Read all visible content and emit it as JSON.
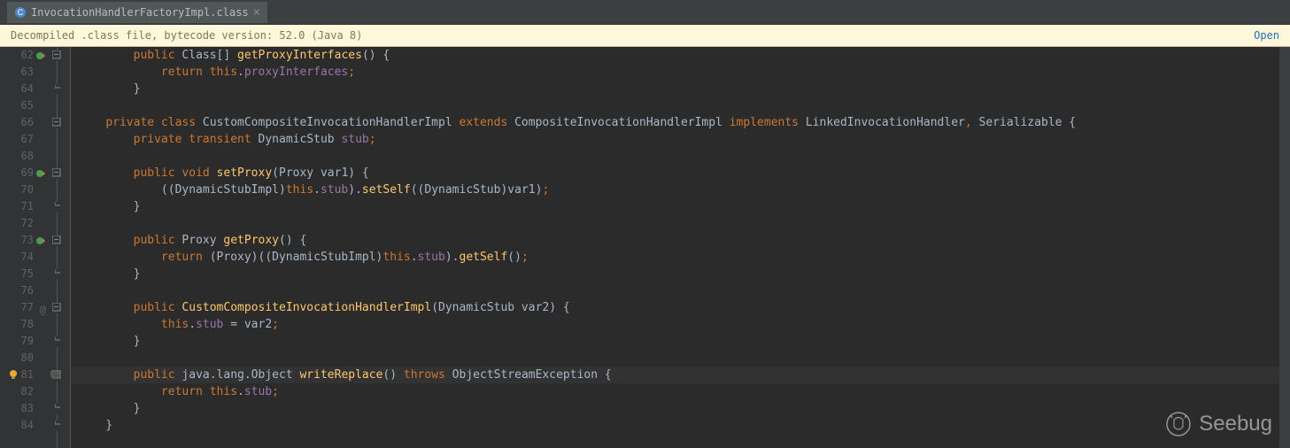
{
  "tab": {
    "filename": "InvocationHandlerFactoryImpl.class"
  },
  "infoBar": {
    "message": "Decompiled .class file, bytecode version: 52.0 (Java 8)",
    "link": "Open"
  },
  "code": {
    "lines": [
      {
        "num": 62,
        "override": true,
        "fold": "open",
        "tokens": [
          [
            "plain",
            "        "
          ],
          [
            "kw",
            "public"
          ],
          [
            "plain",
            " Class[] "
          ],
          [
            "method",
            "getProxyInterfaces"
          ],
          [
            "plain",
            "() {"
          ]
        ]
      },
      {
        "num": 63,
        "tokens": [
          [
            "plain",
            "            "
          ],
          [
            "kw",
            "return "
          ],
          [
            "kw",
            "this"
          ],
          [
            "plain",
            "."
          ],
          [
            "field",
            "proxyInterfaces"
          ],
          [
            "semi",
            ";"
          ]
        ]
      },
      {
        "num": 64,
        "fold": "close",
        "tokens": [
          [
            "plain",
            "        }"
          ]
        ]
      },
      {
        "num": 65,
        "tokens": [
          [
            "plain",
            ""
          ]
        ]
      },
      {
        "num": 66,
        "fold": "open",
        "tokens": [
          [
            "plain",
            "    "
          ],
          [
            "kw",
            "private class"
          ],
          [
            "plain",
            " CustomCompositeInvocationHandlerImpl "
          ],
          [
            "kw",
            "extends"
          ],
          [
            "plain",
            " CompositeInvocationHandlerImpl "
          ],
          [
            "kw",
            "implements"
          ],
          [
            "plain",
            " LinkedInvocationHandler"
          ],
          [
            "semi",
            ","
          ],
          [
            "plain",
            " Serializable {"
          ]
        ]
      },
      {
        "num": 67,
        "tokens": [
          [
            "plain",
            "        "
          ],
          [
            "kw",
            "private transient"
          ],
          [
            "plain",
            " DynamicStub "
          ],
          [
            "field",
            "stub"
          ],
          [
            "semi",
            ";"
          ]
        ]
      },
      {
        "num": 68,
        "tokens": [
          [
            "plain",
            ""
          ]
        ]
      },
      {
        "num": 69,
        "override": true,
        "fold": "open",
        "tokens": [
          [
            "plain",
            "        "
          ],
          [
            "kw",
            "public void "
          ],
          [
            "method",
            "setProxy"
          ],
          [
            "plain",
            "(Proxy var1) {"
          ]
        ]
      },
      {
        "num": 70,
        "tokens": [
          [
            "plain",
            "            ((DynamicStubImpl)"
          ],
          [
            "kw",
            "this"
          ],
          [
            "plain",
            "."
          ],
          [
            "field",
            "stub"
          ],
          [
            "plain",
            ")."
          ],
          [
            "method",
            "setSelf"
          ],
          [
            "plain",
            "((DynamicStub)var1)"
          ],
          [
            "semi",
            ";"
          ]
        ]
      },
      {
        "num": 71,
        "fold": "close",
        "tokens": [
          [
            "plain",
            "        }"
          ]
        ]
      },
      {
        "num": 72,
        "tokens": [
          [
            "plain",
            ""
          ]
        ]
      },
      {
        "num": 73,
        "override": true,
        "fold": "open",
        "tokens": [
          [
            "plain",
            "        "
          ],
          [
            "kw",
            "public"
          ],
          [
            "plain",
            " Proxy "
          ],
          [
            "method",
            "getProxy"
          ],
          [
            "plain",
            "() {"
          ]
        ]
      },
      {
        "num": 74,
        "tokens": [
          [
            "plain",
            "            "
          ],
          [
            "kw",
            "return"
          ],
          [
            "plain",
            " (Proxy)((DynamicStubImpl)"
          ],
          [
            "kw",
            "this"
          ],
          [
            "plain",
            "."
          ],
          [
            "field",
            "stub"
          ],
          [
            "plain",
            ")."
          ],
          [
            "method",
            "getSelf"
          ],
          [
            "plain",
            "()"
          ],
          [
            "semi",
            ";"
          ]
        ]
      },
      {
        "num": 75,
        "fold": "close",
        "tokens": [
          [
            "plain",
            "        }"
          ]
        ]
      },
      {
        "num": 76,
        "tokens": [
          [
            "plain",
            ""
          ]
        ]
      },
      {
        "num": 77,
        "at": true,
        "fold": "open",
        "tokens": [
          [
            "plain",
            "        "
          ],
          [
            "kw",
            "public "
          ],
          [
            "method",
            "CustomCompositeInvocationHandlerImpl"
          ],
          [
            "plain",
            "(DynamicStub var2) {"
          ]
        ]
      },
      {
        "num": 78,
        "tokens": [
          [
            "plain",
            "            "
          ],
          [
            "kw",
            "this"
          ],
          [
            "plain",
            "."
          ],
          [
            "field",
            "stub"
          ],
          [
            "plain",
            " = var2"
          ],
          [
            "semi",
            ";"
          ]
        ]
      },
      {
        "num": 79,
        "fold": "close",
        "tokens": [
          [
            "plain",
            "        }"
          ]
        ]
      },
      {
        "num": 80,
        "tokens": [
          [
            "plain",
            ""
          ]
        ]
      },
      {
        "num": 81,
        "highlight": true,
        "bulb": true,
        "fold": "open",
        "tokens": [
          [
            "plain",
            "        "
          ],
          [
            "kw",
            "public"
          ],
          [
            "plain",
            " java.lang.Object "
          ],
          [
            "method",
            "writeReplace"
          ],
          [
            "plain",
            "() "
          ],
          [
            "kw",
            "throws"
          ],
          [
            "plain",
            " ObjectStreamException {"
          ]
        ]
      },
      {
        "num": 82,
        "tokens": [
          [
            "plain",
            "            "
          ],
          [
            "kw",
            "return "
          ],
          [
            "kw",
            "this"
          ],
          [
            "plain",
            "."
          ],
          [
            "field",
            "stub"
          ],
          [
            "semi",
            ";"
          ]
        ]
      },
      {
        "num": 83,
        "fold": "close",
        "tokens": [
          [
            "plain",
            "        }"
          ]
        ]
      },
      {
        "num": 84,
        "fold": "close",
        "tokens": [
          [
            "plain",
            "    }"
          ]
        ]
      }
    ]
  },
  "watermark": {
    "text": "Seebug"
  }
}
